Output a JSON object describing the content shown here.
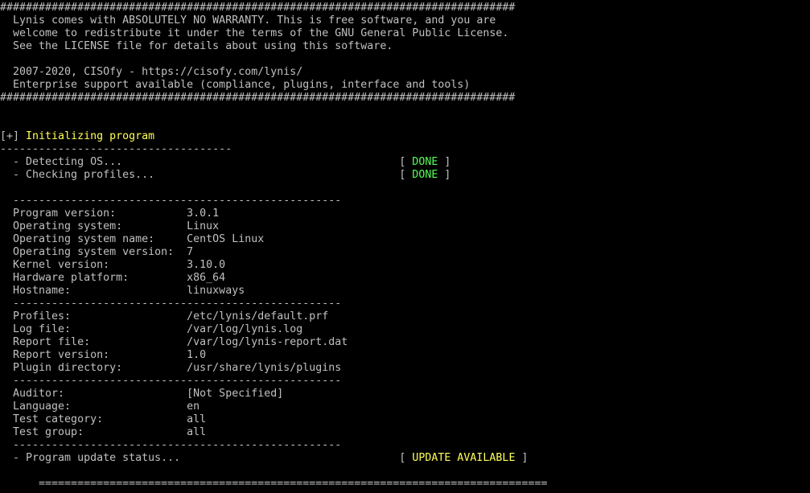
{
  "colors": {
    "background": "#000000",
    "text": "#c0c0c0",
    "heading_yellow": "#ffff55",
    "status_green": "#55ff55",
    "status_yellow": "#ffff55"
  },
  "banner": {
    "border": "################################################################################",
    "lines": [
      "  Lynis comes with ABSOLUTELY NO WARRANTY. This is free software, and you are",
      "  welcome to redistribute it under the terms of the GNU General Public License.",
      "  See the LICENSE file for details about using this software.",
      "",
      "  2007-2020, CISOfy - https://cisofy.com/lynis/",
      "  Enterprise support available (compliance, plugins, interface and tools)"
    ]
  },
  "section": {
    "prefix": "[+] ",
    "title": "Initializing program",
    "underline": "------------------------------------"
  },
  "checks": [
    {
      "label": "  - Detecting OS...                                           [ ",
      "status": "DONE",
      "suffix": " ]"
    },
    {
      "label": "  - Checking profiles...                                      [ ",
      "status": "DONE",
      "suffix": " ]"
    }
  ],
  "separator": "  ---------------------------------------------------",
  "info_groups": [
    [
      "  Program version:           3.0.1",
      "  Operating system:          Linux",
      "  Operating system name:     CentOS Linux",
      "  Operating system version:  7",
      "  Kernel version:            3.10.0",
      "  Hardware platform:         x86_64",
      "  Hostname:                  linuxways"
    ],
    [
      "  Profiles:                  /etc/lynis/default.prf",
      "  Log file:                  /var/log/lynis.log",
      "  Report file:               /var/log/lynis-report.dat",
      "  Report version:            1.0",
      "  Plugin directory:          /usr/share/lynis/plugins"
    ],
    [
      "  Auditor:                   [Not Specified]",
      "  Language:                  en",
      "  Test category:             all",
      "  Test group:                all"
    ]
  ],
  "update": {
    "label": "  - Program update status...                                  [ ",
    "status": "UPDATE AVAILABLE",
    "suffix": " ]"
  },
  "bottom_rule": "      ==============================================================================="
}
